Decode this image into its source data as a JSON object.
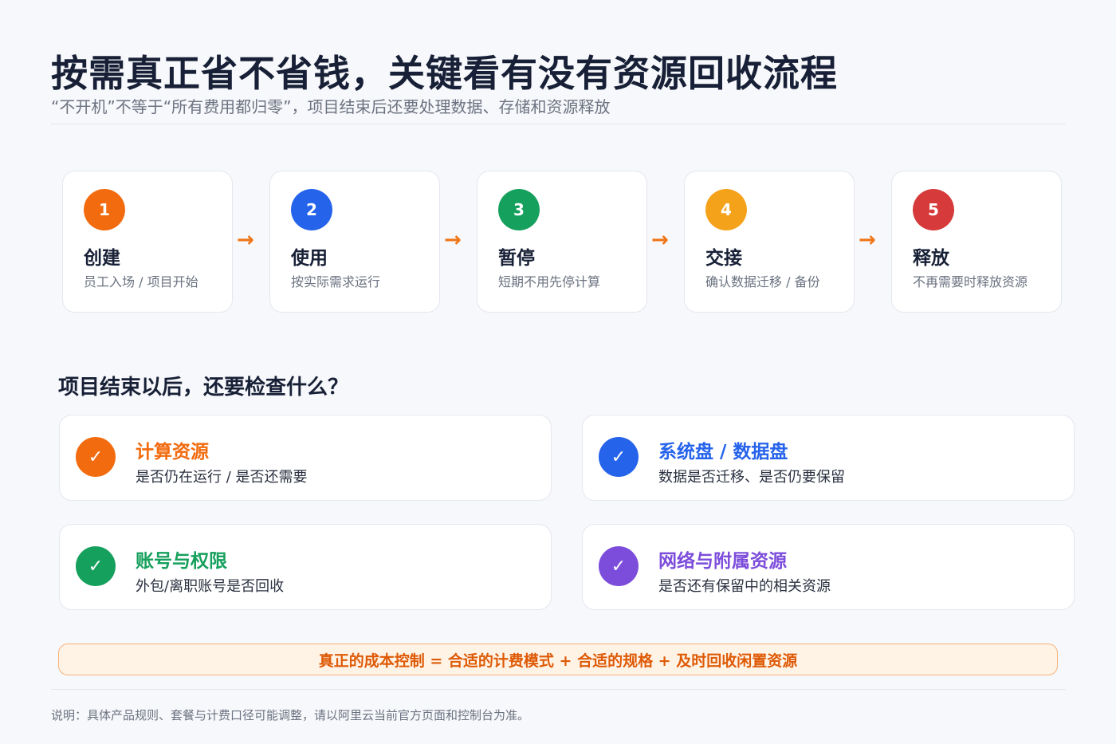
{
  "header": {
    "title": "按需真正省不省钱，关键看有没有资源回收流程",
    "subtitle": "“不开机”不等于“所有费用都归零”，项目结束后还要处理数据、存储和资源释放"
  },
  "flow": {
    "arrow": "→",
    "steps": [
      {
        "number": "1",
        "name": "创建",
        "desc": "员工入场 / 项目开始",
        "color": "#f26b0f"
      },
      {
        "number": "2",
        "name": "使用",
        "desc": "按实际需求运行",
        "color": "#2563eb"
      },
      {
        "number": "3",
        "name": "暂停",
        "desc": "短期不用先停计算",
        "color": "#16a05d"
      },
      {
        "number": "4",
        "name": "交接",
        "desc": "确认数据迁移 / 备份",
        "color": "#f5a21b"
      },
      {
        "number": "5",
        "name": "释放",
        "desc": "不再需要时释放资源",
        "color": "#d63a3a"
      }
    ]
  },
  "checklist": {
    "title": "项目结束以后，还要检查什么？",
    "check_glyph": "✓",
    "items": [
      {
        "title": "计算资源",
        "desc": "是否仍在运行 / 是否还需要",
        "color": "#f26b0f"
      },
      {
        "title": "系统盘 / 数据盘",
        "desc": "数据是否迁移、是否仍要保留",
        "color": "#2563eb"
      },
      {
        "title": "账号与权限",
        "desc": "外包/离职账号是否回收",
        "color": "#16a05d"
      },
      {
        "title": "网络与附属资源",
        "desc": "是否还有保留中的相关资源",
        "color": "#7c4ddb"
      }
    ]
  },
  "banner": {
    "text": "真正的成本控制 = 合适的计费模式 + 合适的规格 + 及时回收闲置资源"
  },
  "footnote": "说明：具体产品规则、套餐与计费口径可能调整，请以阿里云当前官方页面和控制台为准。"
}
